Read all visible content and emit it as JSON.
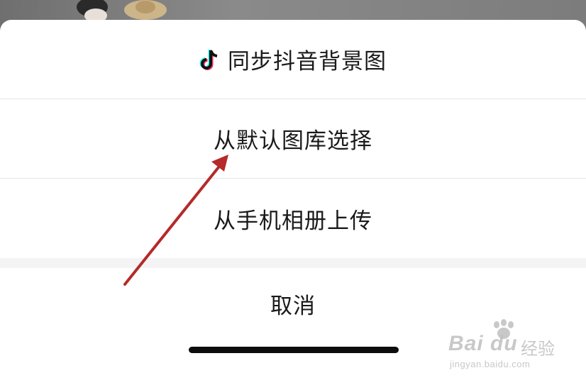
{
  "sheet": {
    "options": [
      {
        "label": "同步抖音背景图",
        "icon": "tiktok-icon"
      },
      {
        "label": "从默认图库选择"
      },
      {
        "label": "从手机相册上传"
      }
    ],
    "cancel_label": "取消"
  },
  "annotation": {
    "color": "#b52a2a",
    "icon": "red-arrow"
  },
  "watermark": {
    "brand": "Bai du",
    "product": "经验",
    "url": "jingyan.baidu.com"
  }
}
